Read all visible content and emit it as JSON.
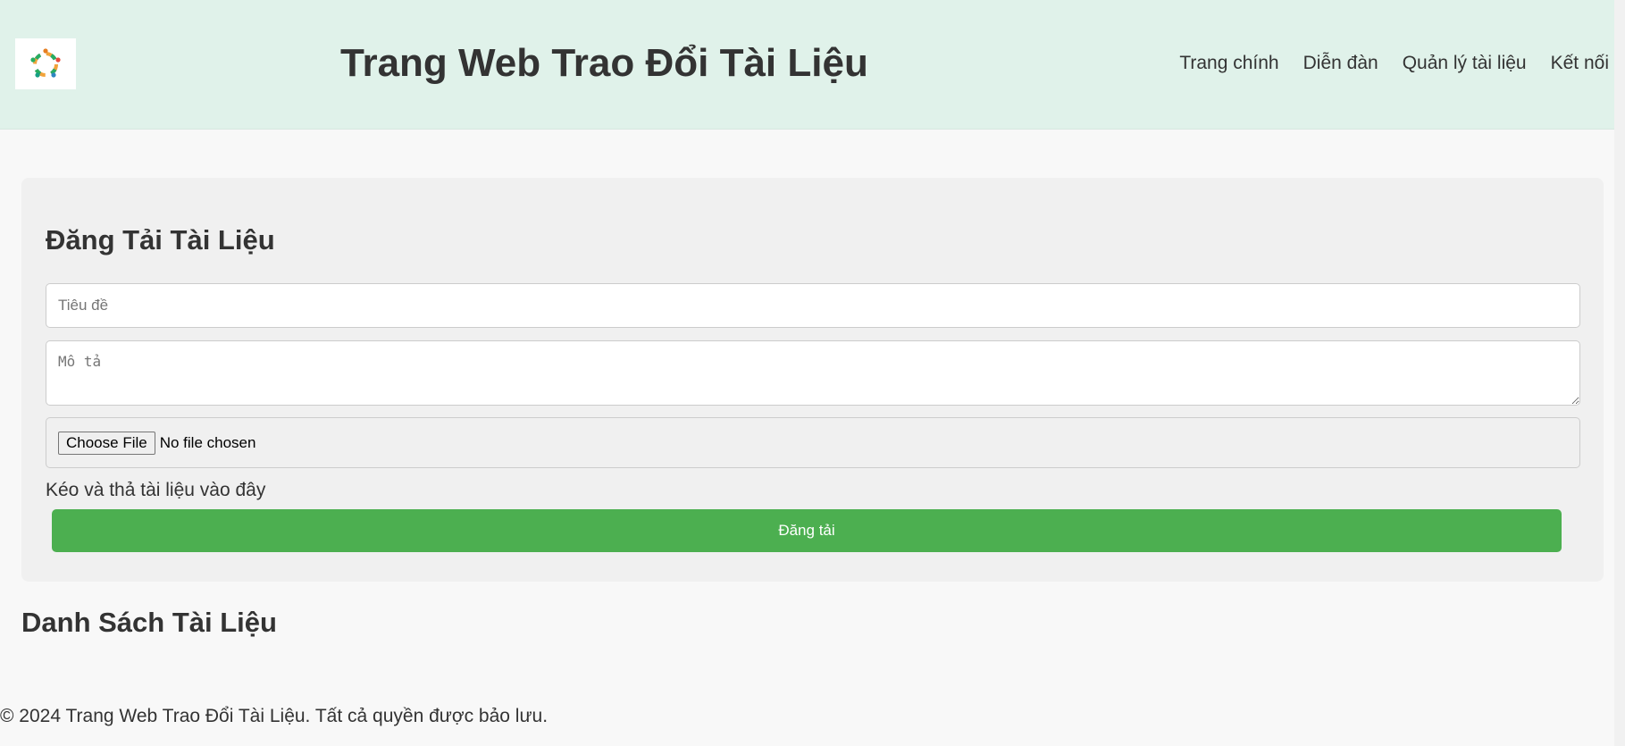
{
  "header": {
    "logo_icon": "circular-people-logo-icon",
    "title": "Trang Web Trao Đổi Tài Liệu",
    "nav": [
      {
        "label": "Trang chính"
      },
      {
        "label": "Diễn đàn"
      },
      {
        "label": "Quản lý tài liệu"
      },
      {
        "label": "Kết nối"
      }
    ]
  },
  "upload": {
    "heading": "Đăng Tải Tài Liệu",
    "title_placeholder": "Tiêu đề",
    "title_value": "",
    "description_placeholder": "Mô tả",
    "description_value": "",
    "file_button_label": "Choose File",
    "file_status": "No file chosen",
    "drop_hint": "Kéo và thả tài liệu vào đây",
    "submit_label": "Đăng tải"
  },
  "documents": {
    "heading": "Danh Sách Tài Liệu"
  },
  "footer": {
    "text": "© 2024 Trang Web Trao Đổi Tài Liệu. Tất cả quyền được bảo lưu."
  },
  "colors": {
    "header_bg": "#e0f2ea",
    "page_bg": "#f8f8f8",
    "card_bg": "#f0f0f0",
    "accent_green": "#4caf50",
    "text": "#333333"
  }
}
